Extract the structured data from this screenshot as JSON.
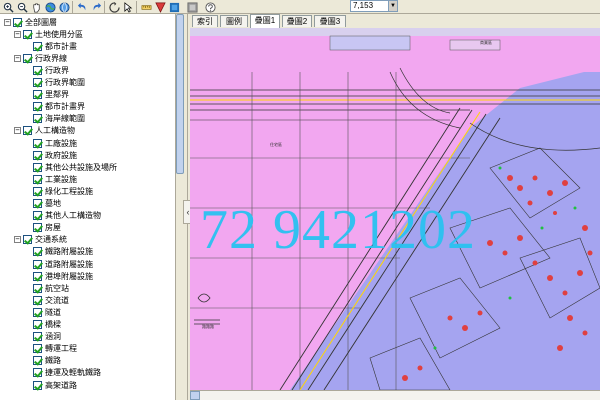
{
  "toolbar": {
    "scale_value": "7,153",
    "icons": [
      "zoom-in-icon",
      "zoom-out-icon",
      "pan-icon",
      "globe-icon",
      "undo-icon",
      "redo-icon",
      "refresh-icon",
      "select-icon",
      "measure-icon",
      "layers-icon",
      "identify-icon",
      "print-icon",
      "help-icon"
    ]
  },
  "tabs": [
    {
      "label": "索引"
    },
    {
      "label": "圖例"
    },
    {
      "label": "疊圖1"
    },
    {
      "label": "疊圖2"
    },
    {
      "label": "疊圖3"
    }
  ],
  "layers": [
    {
      "label": "全部圖層",
      "level": 0,
      "expand": "-"
    },
    {
      "label": "土地使用分區",
      "level": 1,
      "expand": "-"
    },
    {
      "label": "都市計畫",
      "level": 2,
      "expand": ""
    },
    {
      "label": "行政界線",
      "level": 1,
      "expand": "-"
    },
    {
      "label": "行政界",
      "level": 2,
      "expand": ""
    },
    {
      "label": "行政界範圍",
      "level": 2,
      "expand": ""
    },
    {
      "label": "里鄰界",
      "level": 2,
      "expand": ""
    },
    {
      "label": "都市計畫界",
      "level": 2,
      "expand": ""
    },
    {
      "label": "海岸線範圍",
      "level": 2,
      "expand": ""
    },
    {
      "label": "人工構造物",
      "level": 1,
      "expand": "-"
    },
    {
      "label": "工廠設施",
      "level": 2,
      "expand": ""
    },
    {
      "label": "政府設施",
      "level": 2,
      "expand": ""
    },
    {
      "label": "其他公共設施及場所",
      "level": 2,
      "expand": ""
    },
    {
      "label": "工業設施",
      "level": 2,
      "expand": ""
    },
    {
      "label": "綠化工程設施",
      "level": 2,
      "expand": ""
    },
    {
      "label": "墓地",
      "level": 2,
      "expand": ""
    },
    {
      "label": "其他人工構造物",
      "level": 2,
      "expand": ""
    },
    {
      "label": "房屋",
      "level": 2,
      "expand": ""
    },
    {
      "label": "交通系統",
      "level": 1,
      "expand": "-"
    },
    {
      "label": "鐵路附屬設施",
      "level": 2,
      "expand": ""
    },
    {
      "label": "道路附屬設施",
      "level": 2,
      "expand": ""
    },
    {
      "label": "港埠附屬設施",
      "level": 2,
      "expand": ""
    },
    {
      "label": "航空站",
      "level": 2,
      "expand": ""
    },
    {
      "label": "交流道",
      "level": 2,
      "expand": ""
    },
    {
      "label": "隧道",
      "level": 2,
      "expand": ""
    },
    {
      "label": "橋樑",
      "level": 2,
      "expand": ""
    },
    {
      "label": "涵洞",
      "level": 2,
      "expand": ""
    },
    {
      "label": "轉運工程",
      "level": 2,
      "expand": ""
    },
    {
      "label": "鐵路",
      "level": 2,
      "expand": ""
    },
    {
      "label": "捷運及輕軌鐵路",
      "level": 2,
      "expand": ""
    },
    {
      "label": "高架道路",
      "level": 2,
      "expand": ""
    }
  ],
  "map": {
    "watermark": "72 9421202",
    "road_label": "路路路",
    "land_label_1": "住宅區",
    "land_label_2": "商業區",
    "colors": {
      "pink_zone": "#f2a7f0",
      "lavender_zone": "#a5a4f0",
      "watermark": "#29c2f0"
    }
  }
}
